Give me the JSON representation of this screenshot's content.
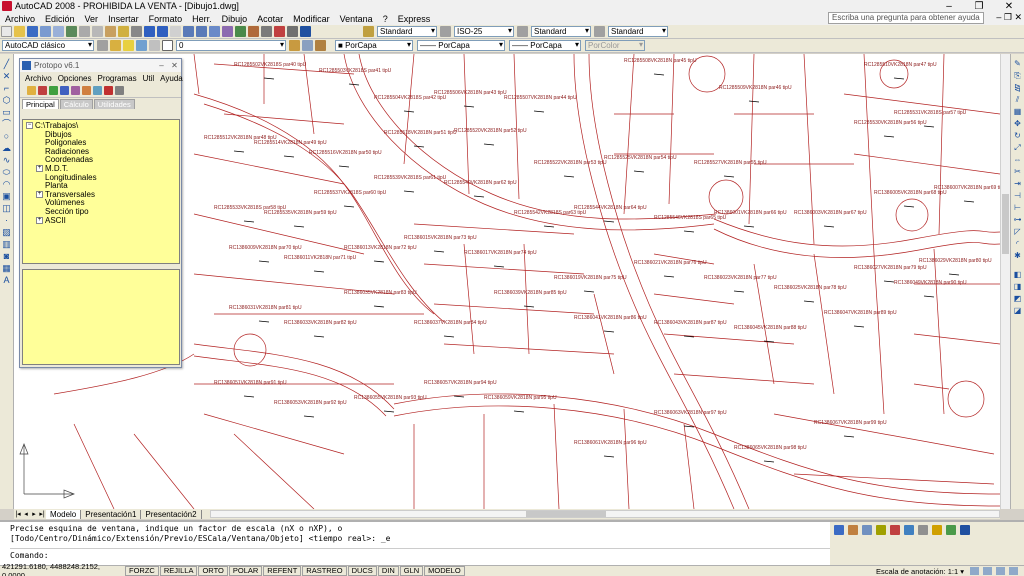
{
  "window": {
    "title": "AutoCAD 2008 - PROHIBIDA LA VENTA - [Dibujo1.dwg]",
    "controls": [
      "–",
      "❐",
      "✕"
    ]
  },
  "menu": {
    "items": [
      "Archivo",
      "Edición",
      "Ver",
      "Insertar",
      "Formato",
      "Herr.",
      "Dibujo",
      "Acotar",
      "Modificar",
      "Ventana",
      "?",
      "Express"
    ],
    "search_placeholder": "Escriba una pregunta para obtener ayuda"
  },
  "toolbar1": {
    "text_style": "Standard",
    "dim_style": "ISO-25",
    "table_style": "Standard",
    "mleader_style": "Standard"
  },
  "toolbar2": {
    "workspace": "AutoCAD clásico",
    "layer": "0",
    "color": "PorCapa",
    "linetype": "PorCapa",
    "lineweight": "PorCapa",
    "plotstyle": "PorColor"
  },
  "protopo": {
    "title": "Protopo v6.1",
    "menu": [
      "Archivo",
      "Opciones",
      "Programas",
      "Util",
      "Ayuda"
    ],
    "tabs": [
      "Principal",
      "Cálculo",
      "Utilidades"
    ],
    "tree": [
      {
        "label": "C:\\Trabajos\\",
        "expander": "−",
        "indent": 0
      },
      {
        "label": "Dibujos",
        "expander": "",
        "indent": 1
      },
      {
        "label": "Poligonales",
        "expander": "",
        "indent": 1
      },
      {
        "label": "Radiaciones",
        "expander": "",
        "indent": 1
      },
      {
        "label": "Coordenadas",
        "expander": "",
        "indent": 1
      },
      {
        "label": "M.D.T.",
        "expander": "+",
        "indent": 1
      },
      {
        "label": "Longitudinales",
        "expander": "",
        "indent": 1
      },
      {
        "label": "Planta",
        "expander": "",
        "indent": 1
      },
      {
        "label": "Transversales",
        "expander": "+",
        "indent": 1
      },
      {
        "label": "Volúmenes",
        "expander": "",
        "indent": 1
      },
      {
        "label": "Sección tipo",
        "expander": "",
        "indent": 1
      },
      {
        "label": "ASCII",
        "expander": "+",
        "indent": 1
      }
    ]
  },
  "parcels": [
    "RC1285502VK2818S par40 tipU",
    "RC1285503VK2818S par41 tipU",
    "RC1285504VK2818S par42 tipU",
    "RC1285506VK2818N par43 tipU",
    "RC1285507VK2818N par44 tipU",
    "RC1285508VK2818N par45 tipU",
    "RC1285509VK2818N par46 tipU",
    "RC1285510VK2818N par47 tipU",
    "RC1285512VK2818N par48 tipU",
    "RC1285514VK2818N par49 tipU",
    "RC1285516VK2818N par50 tipU",
    "RC1285518VK2818N par51 tipU",
    "RC1285520VK2818N par52 tipU",
    "RC1285522VK2818N par53 tipU",
    "RC1285525VK2818N par54 tipU",
    "RC1285527VK2818N par55 tipU",
    "RC1285530VK2818N par56 tipU",
    "RC1285531VK2818S par57 tipU",
    "RC1285533VK2818S par58 tipU",
    "RC1285535VK2818N par59 tipU",
    "RC1285537VK2818S par60 tipU",
    "RC1285539VK2818S par61 tipU",
    "RC1285540VK2818N par62 tipU",
    "RC1285542VK2818S par63 tipU",
    "RC1285544VK2818N par64 tipU",
    "RC1285546VK2818S par65 tipU",
    "RC1386001VK2818N par66 tipU",
    "RC1386003VK2818N par67 tipU",
    "RC1386005VK2818N par68 tipU",
    "RC1386007VK2818N par69 tipU",
    "RC1386009VK2818N par70 tipU",
    "RC1386011VK2818N par71 tipU",
    "RC1386013VK2818N par72 tipU",
    "RC1386015VK2818N par73 tipU",
    "RC1386017VK2818N par74 tipU",
    "RC1386019VK2818N par75 tipU",
    "RC1386021VK2818N par76 tipU",
    "RC1386023VK2818N par77 tipU",
    "RC1386025VK2818N par78 tipU",
    "RC1386027VK2818N par79 tipU",
    "RC1386029VK2818N par80 tipU",
    "RC1386031VK2818N par81 tipU",
    "RC1386033VK2818N par82 tipU",
    "RC1386035VK2818N par83 tipU",
    "RC1386037VK2818N par84 tipU",
    "RC1386039VK2818N par85 tipU",
    "RC1386041VK2818N par86 tipU",
    "RC1386043VK2818N par87 tipU",
    "RC1386045VK2818N par88 tipU",
    "RC1386047VK2818N par89 tipU",
    "RC1386049VK2818N par90 tipU",
    "RC1386051VK2818N par91 tipU",
    "RC1386053VK2818N par92 tipU",
    "RC1386055VK2818N par93 tipU",
    "RC1386057VK2818N par94 tipU",
    "RC1386059VK2818N par95 tipU",
    "RC1386061VK2818N par96 tipU",
    "RC1386063VK2818N par97 tipU",
    "RC1386065VK2818N par98 tipU",
    "RC1386067VK2818N par99 tipU"
  ],
  "layout_tabs": [
    "Modelo",
    "Presentación1",
    "Presentación2"
  ],
  "command": {
    "line1": "Precise esquina de ventana, indique un factor de escala (nX o nXP), o",
    "line2": "[Todo/Centro/Dinámico/Extensión/Previo/ESCala/Ventana/Objeto] <tiempo real>: _e",
    "prompt": "Comando:"
  },
  "status": {
    "coords": "421291.6180, 4488248.2152, 0.0000",
    "buttons": [
      "FORZC",
      "REJILLA",
      "ORTO",
      "POLAR",
      "REFENT",
      "RASTREO",
      "DUCS",
      "DIN",
      "GLN",
      "MODELO"
    ],
    "annotation_scale": "Escala de anotación: 1:1 ▾"
  },
  "colors": {
    "parcel_line": "#b22222",
    "parcel_text": "#8b1a1a",
    "tree_bg": "#ffff99",
    "ui_face": "#ece9d8"
  }
}
